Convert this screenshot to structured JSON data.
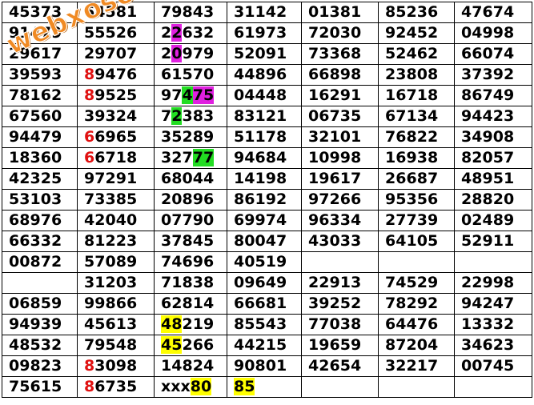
{
  "watermark": "webxoso.net",
  "rows": [
    [
      {
        "t": "45373"
      },
      {
        "t": "64581"
      },
      {
        "t": "79843"
      },
      {
        "t": "31142"
      },
      {
        "t": "01381"
      },
      {
        "t": "85236"
      },
      {
        "t": "47674"
      }
    ],
    [
      {
        "t": "91479"
      },
      {
        "t": "55526"
      },
      {
        "t": "22632",
        "hl": [
          {
            "i": 1,
            "c": "magenta"
          }
        ]
      },
      {
        "t": "61973"
      },
      {
        "t": "72030"
      },
      {
        "t": "92452"
      },
      {
        "t": "04998"
      }
    ],
    [
      {
        "t": "29617"
      },
      {
        "t": "29707"
      },
      {
        "t": "20979",
        "hl": [
          {
            "i": 1,
            "c": "magenta"
          }
        ]
      },
      {
        "t": "52091"
      },
      {
        "t": "73368"
      },
      {
        "t": "52462"
      },
      {
        "t": "66074"
      }
    ],
    [
      {
        "t": "39593"
      },
      {
        "t": "89476",
        "hl": [
          {
            "i": 0,
            "c": "red"
          }
        ]
      },
      {
        "t": "61570"
      },
      {
        "t": "44896"
      },
      {
        "t": "66898"
      },
      {
        "t": "23808"
      },
      {
        "t": "37392"
      }
    ],
    [
      {
        "t": "78162"
      },
      {
        "t": "89525",
        "hl": [
          {
            "i": 0,
            "c": "red"
          }
        ]
      },
      {
        "t": "97475",
        "hl": [
          {
            "i": 2,
            "c": "green"
          },
          {
            "i": 3,
            "c": "magenta"
          },
          {
            "i": 4,
            "c": "magenta"
          }
        ]
      },
      {
        "t": "04448"
      },
      {
        "t": "16291"
      },
      {
        "t": "16718"
      },
      {
        "t": "86749"
      }
    ],
    [
      {
        "t": "67560"
      },
      {
        "t": "39324"
      },
      {
        "t": "72383",
        "hl": [
          {
            "i": 1,
            "c": "green"
          }
        ]
      },
      {
        "t": "83121"
      },
      {
        "t": "06735"
      },
      {
        "t": "67134"
      },
      {
        "t": "94423"
      }
    ],
    [
      {
        "t": "94479"
      },
      {
        "t": "66965",
        "hl": [
          {
            "i": 0,
            "c": "red"
          }
        ]
      },
      {
        "t": "35289"
      },
      {
        "t": "51178"
      },
      {
        "t": "32101"
      },
      {
        "t": "76822"
      },
      {
        "t": "34908"
      }
    ],
    [
      {
        "t": "18360"
      },
      {
        "t": "66718",
        "hl": [
          {
            "i": 0,
            "c": "red"
          }
        ]
      },
      {
        "t": "32777",
        "hl": [
          {
            "i": 3,
            "c": "green"
          },
          {
            "i": 4,
            "c": "green"
          }
        ]
      },
      {
        "t": "94684"
      },
      {
        "t": "10998"
      },
      {
        "t": "16938"
      },
      {
        "t": "82057"
      }
    ],
    [
      {
        "t": "42325"
      },
      {
        "t": "97291"
      },
      {
        "t": "68044"
      },
      {
        "t": "14198"
      },
      {
        "t": "19617"
      },
      {
        "t": "26687"
      },
      {
        "t": "48951"
      }
    ],
    [
      {
        "t": "53103"
      },
      {
        "t": "73385"
      },
      {
        "t": "20896"
      },
      {
        "t": "86192"
      },
      {
        "t": "97266"
      },
      {
        "t": "95356"
      },
      {
        "t": "28820"
      }
    ],
    [
      {
        "t": "68976"
      },
      {
        "t": "42040"
      },
      {
        "t": "07790"
      },
      {
        "t": "69974"
      },
      {
        "t": "96334"
      },
      {
        "t": "27739"
      },
      {
        "t": "02489"
      }
    ],
    [
      {
        "t": "66332"
      },
      {
        "t": "81223"
      },
      {
        "t": "37845"
      },
      {
        "t": "80047"
      },
      {
        "t": "43033"
      },
      {
        "t": "64105"
      },
      {
        "t": "52911"
      }
    ],
    [
      {
        "t": "00872"
      },
      {
        "t": "57089"
      },
      {
        "t": "74696"
      },
      {
        "t": "40519"
      },
      {
        "t": ""
      },
      {
        "t": ""
      },
      {
        "t": ""
      }
    ],
    [
      {
        "t": ""
      },
      {
        "t": "31203"
      },
      {
        "t": "71838"
      },
      {
        "t": "09649"
      },
      {
        "t": "22913"
      },
      {
        "t": "74529"
      },
      {
        "t": "22998"
      }
    ],
    [
      {
        "t": "06859"
      },
      {
        "t": "99866"
      },
      {
        "t": "62814"
      },
      {
        "t": "66681"
      },
      {
        "t": "39252"
      },
      {
        "t": "78292"
      },
      {
        "t": "94247"
      }
    ],
    [
      {
        "t": "94939"
      },
      {
        "t": "45613"
      },
      {
        "t": "48219",
        "hl": [
          {
            "i": 0,
            "c": "yellow"
          },
          {
            "i": 1,
            "c": "yellow"
          }
        ]
      },
      {
        "t": "85543"
      },
      {
        "t": "77038"
      },
      {
        "t": "64476"
      },
      {
        "t": "13332"
      }
    ],
    [
      {
        "t": "48532"
      },
      {
        "t": "79548"
      },
      {
        "t": "45266",
        "hl": [
          {
            "i": 0,
            "c": "yellow"
          },
          {
            "i": 1,
            "c": "yellow"
          }
        ]
      },
      {
        "t": "44215"
      },
      {
        "t": "19659"
      },
      {
        "t": "87204"
      },
      {
        "t": "34623"
      }
    ],
    [
      {
        "t": "09823"
      },
      {
        "t": "83098",
        "hl": [
          {
            "i": 0,
            "c": "red"
          }
        ]
      },
      {
        "t": "14824"
      },
      {
        "t": "90801"
      },
      {
        "t": "42654"
      },
      {
        "t": "32217"
      },
      {
        "t": "00745"
      }
    ],
    [
      {
        "t": "75615"
      },
      {
        "t": "86735",
        "hl": [
          {
            "i": 0,
            "c": "red"
          }
        ]
      },
      {
        "t": "xxx80",
        "hl": [
          {
            "i": 3,
            "c": "yellow"
          },
          {
            "i": 4,
            "c": "yellow"
          }
        ]
      },
      {
        "t": "85",
        "hl": [
          {
            "i": 0,
            "c": "yellow"
          },
          {
            "i": 1,
            "c": "yellow"
          }
        ]
      },
      {
        "t": ""
      },
      {
        "t": ""
      },
      {
        "t": ""
      }
    ]
  ]
}
